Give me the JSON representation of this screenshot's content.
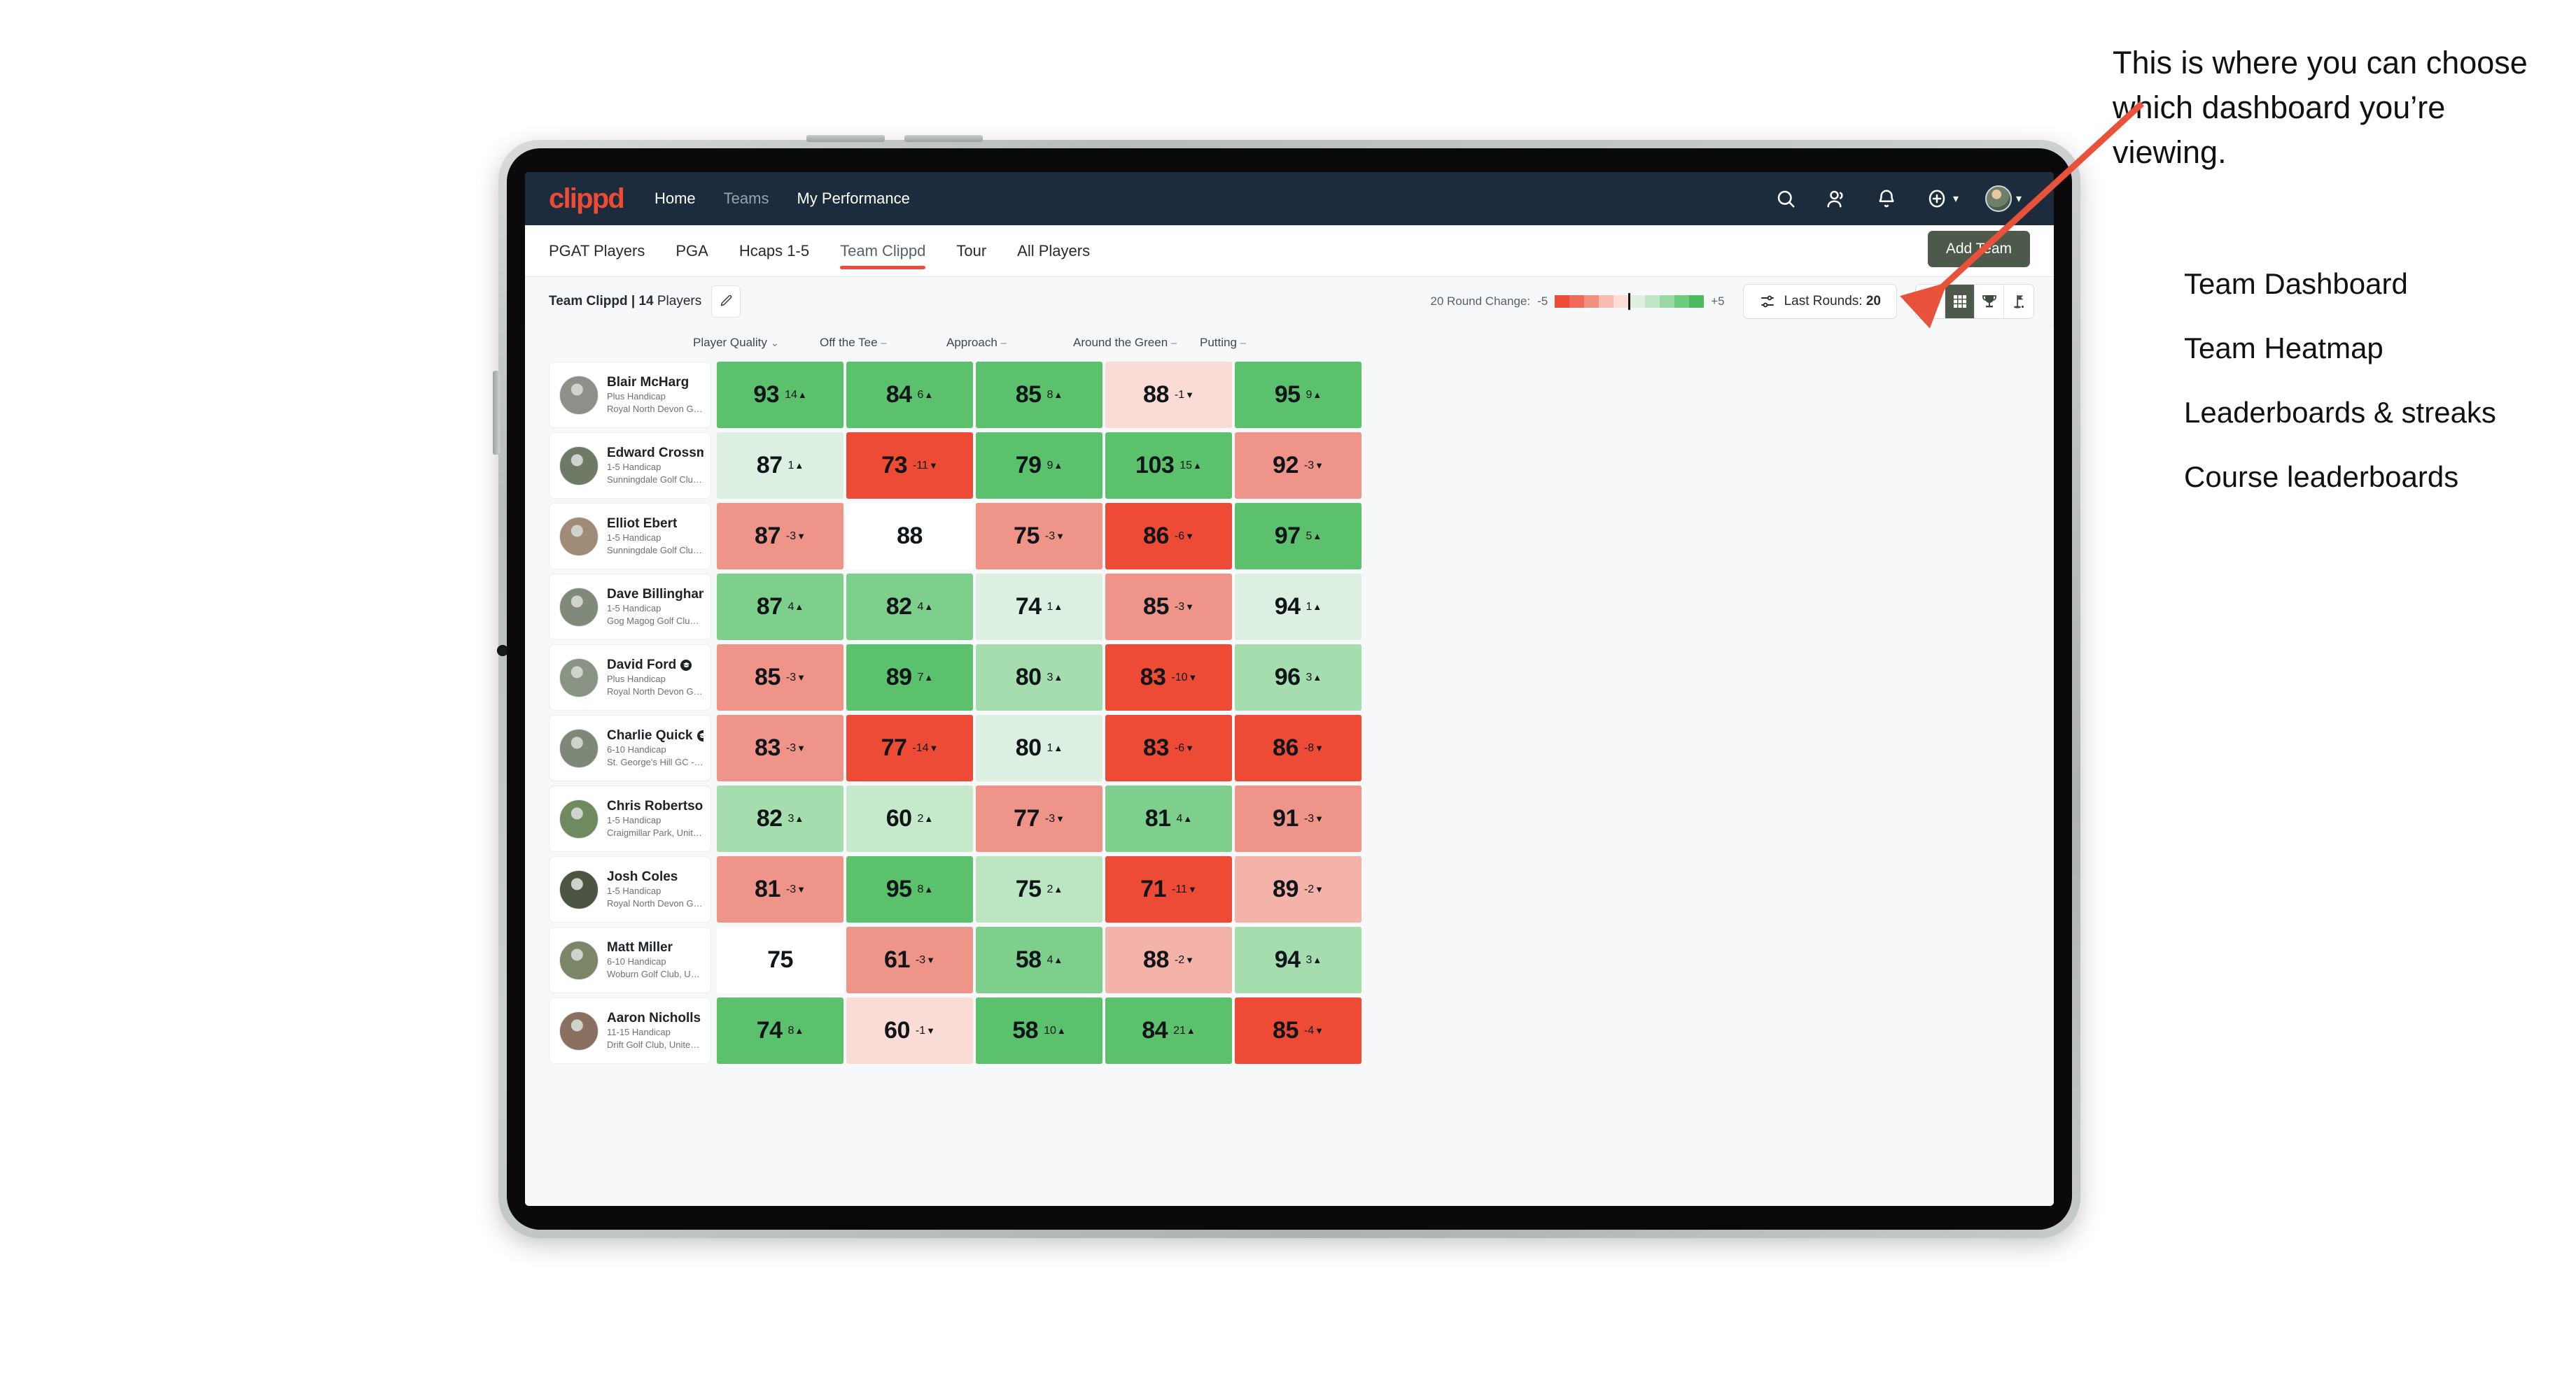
{
  "topnav": {
    "logo": "clippd",
    "links": [
      {
        "label": "Home",
        "dim": false
      },
      {
        "label": "Teams",
        "dim": true
      },
      {
        "label": "My Performance",
        "dim": false
      }
    ],
    "icons": [
      "search-icon",
      "people-icon",
      "bell-icon",
      "plus-circle-icon"
    ],
    "avatar_caret": "∨"
  },
  "tabs": [
    {
      "label": "PGAT Players",
      "active": false
    },
    {
      "label": "PGA",
      "active": false
    },
    {
      "label": "Hcaps 1-5",
      "active": false
    },
    {
      "label": "Team Clippd",
      "active": true
    },
    {
      "label": "Tour",
      "active": false
    },
    {
      "label": "All Players",
      "active": false
    }
  ],
  "add_team_label": "Add Team",
  "subbar": {
    "team_name_bold": "Team Clippd | 14",
    "team_name_rest": " Players",
    "legend_label": "20 Round Change:",
    "legend_min": "-5",
    "legend_max": "+5",
    "legend_colors": [
      "#ee4b36",
      "#ef6a57",
      "#f2907f",
      "#f7bdb2",
      "#fbdcd6",
      "#dff0e2",
      "#c2e6c8",
      "#9ad9a5",
      "#6ecc80",
      "#4cbb5f"
    ],
    "rounds_label_text": "Last Rounds: ",
    "rounds_label_value": "20",
    "view_toggles": [
      {
        "icon": "grid-2x2-icon",
        "name": "team-dashboard",
        "active": false
      },
      {
        "icon": "grid-3x3-icon",
        "name": "team-heatmap",
        "active": true
      },
      {
        "icon": "trophy-icon",
        "name": "leaderboards-streaks",
        "active": false
      },
      {
        "icon": "flagstick-icon",
        "name": "course-leaderboards",
        "active": false
      }
    ]
  },
  "table": {
    "columns": [
      {
        "label": "Player Quality",
        "sym": "⌄"
      },
      {
        "label": "Off the Tee",
        "sym": "–"
      },
      {
        "label": "Approach",
        "sym": "–"
      },
      {
        "label": "Around the Green",
        "sym": "–"
      },
      {
        "label": "Putting",
        "sym": "–"
      }
    ],
    "rows": [
      {
        "name": "Blair McHarg",
        "badge": false,
        "handicap": "Plus Handicap",
        "club": "Royal North Devon Golf Club, United Kingdom",
        "avatar": "#8d8f8a",
        "cells": [
          {
            "value": "93",
            "delta": "14",
            "dir": "up",
            "bg": "#5cc16c"
          },
          {
            "value": "84",
            "delta": "6",
            "dir": "up",
            "bg": "#5cc16c"
          },
          {
            "value": "85",
            "delta": "8",
            "dir": "up",
            "bg": "#5cc16c"
          },
          {
            "value": "88",
            "delta": "-1",
            "dir": "down",
            "bg": "#fadcd6"
          },
          {
            "value": "95",
            "delta": "9",
            "dir": "up",
            "bg": "#5cc16c"
          }
        ]
      },
      {
        "name": "Edward Crossman",
        "badge": false,
        "handicap": "1-5 Handicap",
        "club": "Sunningdale Golf Club, United Kingdom",
        "avatar": "#6f7a66",
        "cells": [
          {
            "value": "87",
            "delta": "1",
            "dir": "up",
            "bg": "#dcefe0"
          },
          {
            "value": "73",
            "delta": "-11",
            "dir": "down",
            "bg": "#ee4b36"
          },
          {
            "value": "79",
            "delta": "9",
            "dir": "up",
            "bg": "#5cc16c"
          },
          {
            "value": "103",
            "delta": "15",
            "dir": "up",
            "bg": "#5cc16c"
          },
          {
            "value": "92",
            "delta": "-3",
            "dir": "down",
            "bg": "#ef9489"
          }
        ]
      },
      {
        "name": "Elliot Ebert",
        "badge": false,
        "handicap": "1-5 Handicap",
        "club": "Sunningdale Golf Club, United Kingdom",
        "avatar": "#a08a78",
        "cells": [
          {
            "value": "87",
            "delta": "-3",
            "dir": "down",
            "bg": "#ef9489"
          },
          {
            "value": "88",
            "delta": "",
            "dir": "",
            "bg": "#ffffff"
          },
          {
            "value": "75",
            "delta": "-3",
            "dir": "down",
            "bg": "#ef9489"
          },
          {
            "value": "86",
            "delta": "-6",
            "dir": "down",
            "bg": "#ee4b36"
          },
          {
            "value": "97",
            "delta": "5",
            "dir": "up",
            "bg": "#5cc16c"
          }
        ]
      },
      {
        "name": "Dave Billingham",
        "badge": false,
        "handicap": "1-5 Handicap",
        "club": "Gog Magog Golf Club, United Kingdom",
        "avatar": "#7f8a7a",
        "cells": [
          {
            "value": "87",
            "delta": "4",
            "dir": "up",
            "bg": "#7fcf8c"
          },
          {
            "value": "82",
            "delta": "4",
            "dir": "up",
            "bg": "#7fcf8c"
          },
          {
            "value": "74",
            "delta": "1",
            "dir": "up",
            "bg": "#dcefe0"
          },
          {
            "value": "85",
            "delta": "-3",
            "dir": "down",
            "bg": "#ef9489"
          },
          {
            "value": "94",
            "delta": "1",
            "dir": "up",
            "bg": "#dcefe0"
          }
        ]
      },
      {
        "name": "David Ford",
        "badge": true,
        "handicap": "Plus Handicap",
        "club": "Royal North Devon Golf Club, United Kingdom",
        "avatar": "#8a9485",
        "cells": [
          {
            "value": "85",
            "delta": "-3",
            "dir": "down",
            "bg": "#ef9489"
          },
          {
            "value": "89",
            "delta": "7",
            "dir": "up",
            "bg": "#5cc16c"
          },
          {
            "value": "80",
            "delta": "3",
            "dir": "up",
            "bg": "#a6ddae"
          },
          {
            "value": "83",
            "delta": "-10",
            "dir": "down",
            "bg": "#ee4b36"
          },
          {
            "value": "96",
            "delta": "3",
            "dir": "up",
            "bg": "#a6ddae"
          }
        ]
      },
      {
        "name": "Charlie Quick",
        "badge": true,
        "handicap": "6-10 Handicap",
        "club": "St. George's Hill GC - Weybridge - Surrey, Uni...",
        "avatar": "#7e8878",
        "cells": [
          {
            "value": "83",
            "delta": "-3",
            "dir": "down",
            "bg": "#ef9489"
          },
          {
            "value": "77",
            "delta": "-14",
            "dir": "down",
            "bg": "#ee4b36"
          },
          {
            "value": "80",
            "delta": "1",
            "dir": "up",
            "bg": "#dcefe0"
          },
          {
            "value": "83",
            "delta": "-6",
            "dir": "down",
            "bg": "#ee4b36"
          },
          {
            "value": "86",
            "delta": "-8",
            "dir": "down",
            "bg": "#ee4b36"
          }
        ]
      },
      {
        "name": "Chris Robertson",
        "badge": true,
        "handicap": "1-5 Handicap",
        "club": "Craigmillar Park, United Kingdom",
        "avatar": "#6f8a5f",
        "cells": [
          {
            "value": "82",
            "delta": "3",
            "dir": "up",
            "bg": "#a6ddae"
          },
          {
            "value": "60",
            "delta": "2",
            "dir": "up",
            "bg": "#c6e9cb"
          },
          {
            "value": "77",
            "delta": "-3",
            "dir": "down",
            "bg": "#ef9489"
          },
          {
            "value": "81",
            "delta": "4",
            "dir": "up",
            "bg": "#7fcf8c"
          },
          {
            "value": "91",
            "delta": "-3",
            "dir": "down",
            "bg": "#ef9489"
          }
        ]
      },
      {
        "name": "Josh Coles",
        "badge": false,
        "handicap": "1-5 Handicap",
        "club": "Royal North Devon Golf Club, United Kingdom",
        "avatar": "#4c5543",
        "cells": [
          {
            "value": "81",
            "delta": "-3",
            "dir": "down",
            "bg": "#ef9489"
          },
          {
            "value": "95",
            "delta": "8",
            "dir": "up",
            "bg": "#5cc16c"
          },
          {
            "value": "75",
            "delta": "2",
            "dir": "up",
            "bg": "#bce6c2"
          },
          {
            "value": "71",
            "delta": "-11",
            "dir": "down",
            "bg": "#ee4b36"
          },
          {
            "value": "89",
            "delta": "-2",
            "dir": "down",
            "bg": "#f4b3a8"
          }
        ]
      },
      {
        "name": "Matt Miller",
        "badge": false,
        "handicap": "6-10 Handicap",
        "club": "Woburn Golf Club, United Kingdom",
        "avatar": "#7b8568",
        "cells": [
          {
            "value": "75",
            "delta": "",
            "dir": "",
            "bg": "#ffffff"
          },
          {
            "value": "61",
            "delta": "-3",
            "dir": "down",
            "bg": "#ef9489"
          },
          {
            "value": "58",
            "delta": "4",
            "dir": "up",
            "bg": "#7fcf8c"
          },
          {
            "value": "88",
            "delta": "-2",
            "dir": "down",
            "bg": "#f4b3a8"
          },
          {
            "value": "94",
            "delta": "3",
            "dir": "up",
            "bg": "#a6ddae"
          }
        ]
      },
      {
        "name": "Aaron Nicholls",
        "badge": false,
        "handicap": "11-15 Handicap",
        "club": "Drift Golf Club, United Kingdom",
        "avatar": "#8a7060",
        "cells": [
          {
            "value": "74",
            "delta": "8",
            "dir": "up",
            "bg": "#5cc16c"
          },
          {
            "value": "60",
            "delta": "-1",
            "dir": "down",
            "bg": "#fadcd6"
          },
          {
            "value": "58",
            "delta": "10",
            "dir": "up",
            "bg": "#5cc16c"
          },
          {
            "value": "84",
            "delta": "21",
            "dir": "up",
            "bg": "#5cc16c"
          },
          {
            "value": "85",
            "delta": "-4",
            "dir": "down",
            "bg": "#ee4b36"
          }
        ]
      }
    ]
  },
  "annotation": {
    "callout": "This is where you can choose which dashboard you’re viewing.",
    "items": [
      "Team Dashboard",
      "Team Heatmap",
      "Leaderboards & streaks",
      "Course leaderboards"
    ],
    "arrow_color": "#e8513a"
  }
}
